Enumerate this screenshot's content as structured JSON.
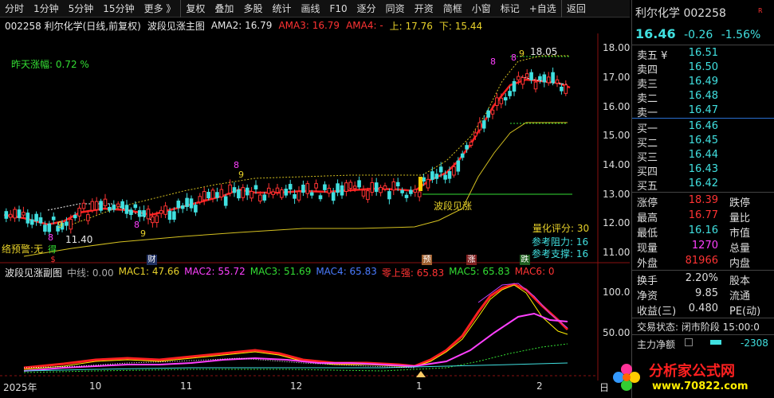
{
  "toolbar": {
    "items": [
      "分时",
      "1分钟",
      "5分钟",
      "15分钟",
      "更多 》",
      "复权",
      "叠加",
      "多股",
      "统计",
      "画线",
      "F10",
      "逐分",
      "同资",
      "开资",
      "简框",
      "小窗",
      "标记",
      "+自选",
      "返回"
    ]
  },
  "header": {
    "stock": "002258 利尔化学(日线,前复权)",
    "main_indicator": "波段见涨主图",
    "ama2": "AMA2: 16.79",
    "ama3": "AMA3: 16.79",
    "ama4": "AMA4: -",
    "up": "上: 17.76",
    "down": "下: 15.44",
    "yesterday_gain": "昨天涨幅:  0.72 %",
    "high_label": "18.05",
    "low_label": "11.40",
    "signal_label": "波段见涨",
    "score": "量化评分:  30",
    "resist": "参考阻力: 16",
    "support": "参考支撑: 16",
    "left_bottom": "络预警:无 ",
    "left_bottom2": "得"
  },
  "sub_header": {
    "name": "波段见涨副图",
    "mid": "中线: 0.00",
    "mac1": "MAC1: 47.66",
    "mac2": "MAC2: 55.72",
    "mac3": "MAC3: 51.69",
    "mac4": "MAC4: 65.83",
    "zero": "零上强: 65.83",
    "mac5": "MAC5: 65.83",
    "mac6": "MAC6: 0"
  },
  "price_axis": [
    "18.00",
    "17.00",
    "16.00",
    "15.00",
    "14.00",
    "13.00",
    "12.00",
    "11.00"
  ],
  "sub_axis": [
    "100.0",
    "50.00"
  ],
  "x_axis": [
    "2025年",
    "10",
    "11",
    "12",
    "1",
    "2",
    "日"
  ],
  "markers": [
    {
      "text": "$",
      "color": "#ff3333"
    },
    {
      "text": "财",
      "color": "#4a7bff"
    },
    {
      "text": "预",
      "color": "#ffffff"
    },
    {
      "text": "涨",
      "color": "#ffffff"
    },
    {
      "text": "跌",
      "color": "#ffffff"
    }
  ],
  "seq_labels": [
    "8",
    "9",
    "8",
    "9",
    "8",
    "9",
    "8",
    "8",
    "9"
  ],
  "panel": {
    "name": "利尔化学",
    "code": "002258",
    "badge": "R",
    "price": "16.46",
    "change": "-0.26",
    "pct": "-1.56%",
    "asks": [
      {
        "label": "卖五 ¥",
        "value": "16.51"
      },
      {
        "label": "卖四",
        "value": "16.50"
      },
      {
        "label": "卖三",
        "value": "16.49"
      },
      {
        "label": "卖二",
        "value": "16.48"
      },
      {
        "label": "卖一",
        "value": "16.47"
      }
    ],
    "bids": [
      {
        "label": "买一",
        "value": "16.46"
      },
      {
        "label": "买二",
        "value": "16.45"
      },
      {
        "label": "买三",
        "value": "16.44"
      },
      {
        "label": "买四",
        "value": "16.43"
      },
      {
        "label": "买五",
        "value": "16.42"
      }
    ],
    "stats": [
      {
        "label": "涨停",
        "value": "18.39",
        "label2": "跌停",
        "color": "#ff3333"
      },
      {
        "label": "最高",
        "value": "16.77",
        "label2": "量比",
        "color": "#ff3333"
      },
      {
        "label": "最低",
        "value": "16.16",
        "label2": "市值",
        "color": "#40e0e0"
      },
      {
        "label": "现量",
        "value": "1270",
        "label2": "总量",
        "color": "#ff40ff"
      },
      {
        "label": "外盘",
        "value": "81966",
        "label2": "内盘",
        "color": "#ff3333"
      }
    ],
    "stats2": [
      {
        "label": "换手",
        "value": "2.20%",
        "label2": "股本",
        "color": "#dddddd"
      },
      {
        "label": "净资",
        "value": "9.85",
        "label2": "流通",
        "color": "#dddddd"
      },
      {
        "label": "收益(三)",
        "value": "0.480",
        "label2": "PE(动)",
        "color": "#dddddd"
      }
    ],
    "trade_status": "交易状态: 闭市阶段 15:00:0",
    "main_flow_label": "主力净额",
    "main_flow_value": "-2308"
  },
  "watermark": {
    "site_text": "分析家公式网",
    "site_url": "www.70822.com"
  },
  "colors": {
    "up": "#ff3333",
    "down": "#40e0e0",
    "ma": "#ff2020",
    "band": "#d4c020",
    "level": "#33dd33"
  }
}
